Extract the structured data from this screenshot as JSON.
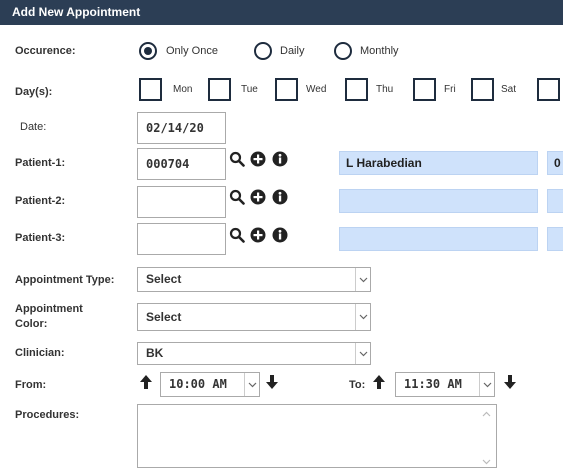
{
  "title": "Add New Appointment",
  "occurrence": {
    "label": "Occurence:",
    "options": [
      "Only Once",
      "Daily",
      "Monthly"
    ],
    "selected": "Only Once"
  },
  "days": {
    "label": "Day(s):",
    "items": [
      "Mon",
      "Tue",
      "Wed",
      "Thu",
      "Fri",
      "Sat"
    ]
  },
  "date": {
    "label": "Date:",
    "value": "02/14/20"
  },
  "patients": [
    {
      "label": "Patient-1:",
      "id": "000704",
      "name": "L Harabedian",
      "extra": "0"
    },
    {
      "label": "Patient-2:",
      "id": "",
      "name": "",
      "extra": ""
    },
    {
      "label": "Patient-3:",
      "id": "",
      "name": "",
      "extra": ""
    }
  ],
  "appointment_type": {
    "label": "Appointment Type:",
    "value": "Select"
  },
  "appointment_color": {
    "label_line1": "Appointment",
    "label_line2": "Color:",
    "value": "Select"
  },
  "clinician": {
    "label": "Clinician:",
    "value": "BK"
  },
  "from": {
    "label": "From:",
    "value": "10:00 AM"
  },
  "to": {
    "label": "To:",
    "value": "11:30 AM"
  },
  "procedures": {
    "label": "Procedures:",
    "value": ""
  },
  "icons": [
    "search-icon",
    "plus-circle-icon",
    "info-circle-icon",
    "arrow-up-icon",
    "arrow-down-icon",
    "chevron-down-icon"
  ],
  "colors": {
    "titlebar": "#2c3e55",
    "patient_name_bg": "#cfe2fb"
  }
}
